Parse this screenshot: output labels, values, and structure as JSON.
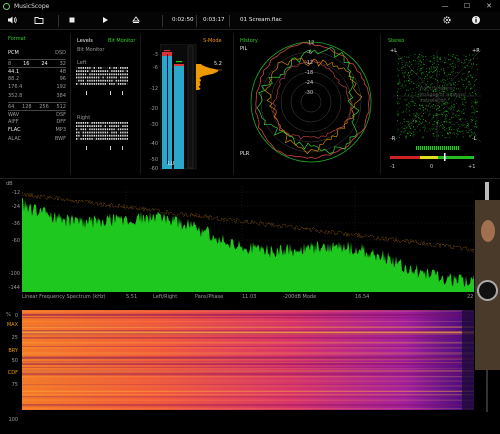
{
  "window": {
    "title": "MusicScope",
    "controls": [
      "—",
      "☐",
      "✕"
    ]
  },
  "toolbar": {
    "position": "0:02:50",
    "duration": "0:03:17",
    "filename": "01 Scream.flac"
  },
  "format_panel": {
    "title": "Format",
    "rows": [
      [
        "PCM",
        "DSD"
      ],
      [
        "8",
        "16",
        "24",
        "32"
      ],
      [
        "44.1",
        "48"
      ],
      [
        "88.2",
        "96"
      ],
      [
        "176.4",
        "192"
      ],
      [
        "352.8",
        "384"
      ],
      [
        "64",
        "128",
        "256",
        "512"
      ],
      [
        "WAV",
        "DSF"
      ],
      [
        "AIFF",
        "DFF"
      ],
      [
        "FLAC",
        "MP3"
      ],
      [
        "ALAC",
        "BWF"
      ]
    ]
  },
  "levels_panel": {
    "title": "Levels",
    "mode": "Bit Monitor",
    "sub": "Bit Monitor",
    "left": "Left",
    "right": "Right",
    "s_mode": "S-Mode",
    "scale": [
      "-3",
      "-6",
      "-12",
      "-20",
      "-30",
      "-40",
      "-50",
      "-60"
    ],
    "peak_value": "5.2",
    "lr_label": "LU"
  },
  "history_panel": {
    "title": "History",
    "pil": "PIL",
    "plr": "PLR",
    "rings": [
      "12",
      "-6",
      "-12",
      "-18",
      "-24",
      "-30"
    ]
  },
  "stereo_panel": {
    "title": "Stereo",
    "corner_tl": "+L",
    "corner_tr": "+R",
    "corner_bl": "-R",
    "corner_br": "-L",
    "scale_left": "-1",
    "scale_mid": "0",
    "scale_right": "+1",
    "note": "not the stereo images of a phase correlation"
  },
  "spectrum": {
    "db_label": "dB",
    "y_labels": [
      "-12",
      "-24",
      "-36",
      "-60",
      "-100",
      "-144"
    ],
    "footer": "Linear Frequency Spectrum (kHz)",
    "freq_ticks": [
      "5.51",
      "11.03",
      "16.54",
      "22"
    ],
    "mode_labels": [
      "Left/Right",
      "Pans/Phase",
      "-200dB Mode"
    ]
  },
  "spectrogram": {
    "pct_label": "%",
    "y_labels_orange": [
      "MAX",
      "BRY",
      "CDF"
    ],
    "y_labels": [
      "0",
      "25",
      "50",
      "75",
      "100"
    ]
  }
}
